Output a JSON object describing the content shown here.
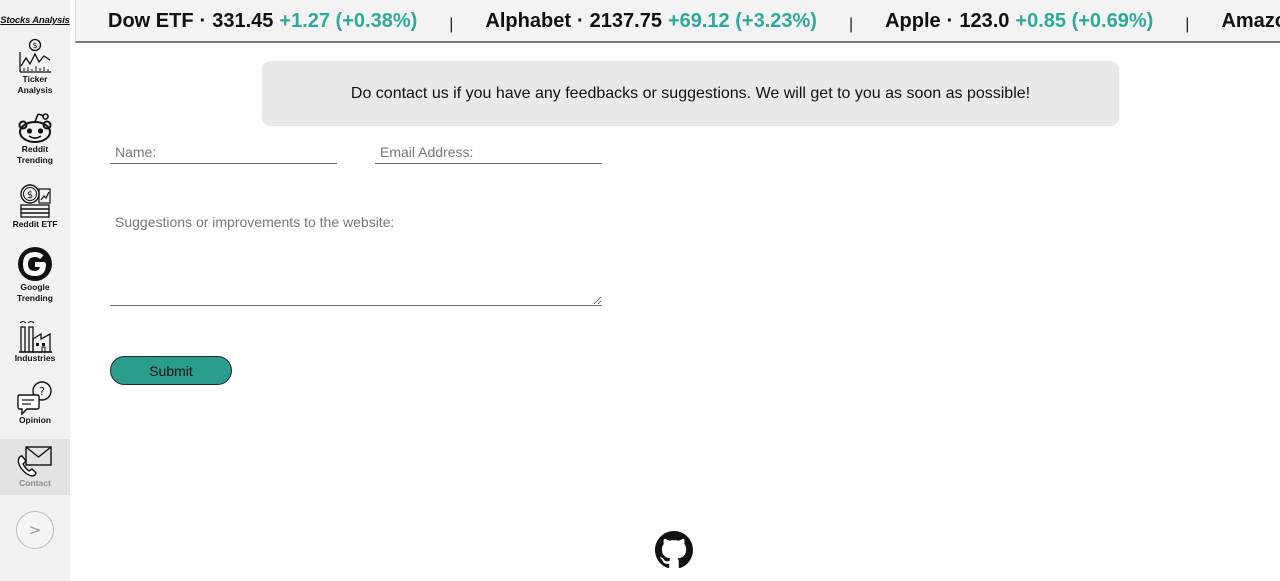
{
  "sidebar": {
    "brand": "Stocks Analysis",
    "items": [
      {
        "label_line1": "Ticker",
        "label_line2": "Analysis",
        "icon": "chart-dollar-icon"
      },
      {
        "label_line1": "Reddit",
        "label_line2": "Trending",
        "icon": "reddit-icon"
      },
      {
        "label_line1": "Reddit ETF",
        "label_line2": "",
        "icon": "coins-icon"
      },
      {
        "label_line1": "Google",
        "label_line2": "Trending",
        "icon": "google-icon"
      },
      {
        "label_line1": "Industries",
        "label_line2": "",
        "icon": "factory-icon"
      },
      {
        "label_line1": "Opinion",
        "label_line2": "",
        "icon": "speech-question-icon"
      },
      {
        "label_line1": "Contact",
        "label_line2": "",
        "icon": "mail-phone-icon",
        "active": true
      }
    ],
    "expand_label": ">"
  },
  "ticker": [
    {
      "name": "Dow ETF",
      "price": "331.45",
      "change": "+1.27 (+0.38%)"
    },
    {
      "name": "Alphabet",
      "price": "2137.75",
      "change": "+69.12 (+3.23%)"
    },
    {
      "name": "Apple",
      "price": "123.0",
      "change": "+0.85 (+0.69%)"
    },
    {
      "name": "Amazon",
      "price": "",
      "change": ""
    }
  ],
  "ticker_separator": "|",
  "ticker_dot": "·",
  "banner": {
    "text": "Do contact us if you have any feedbacks or suggestions. We will get to you as soon as possible!"
  },
  "form": {
    "name_placeholder": "Name:",
    "email_placeholder": "Email Address:",
    "suggestion_placeholder": "Suggestions or improvements to the website:",
    "submit_label": "Submit"
  },
  "footer": {
    "icon": "github-icon"
  },
  "colors": {
    "accent": "#2a9d8f",
    "positive_change": "#2eaa98",
    "sidebar_bg": "#f1f2f2",
    "banner_bg": "#e8eaea"
  }
}
